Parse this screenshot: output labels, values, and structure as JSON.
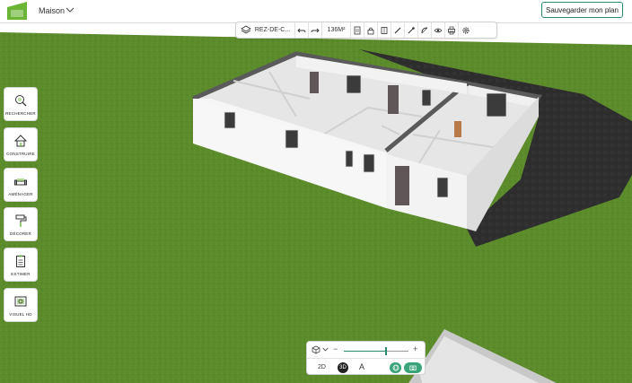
{
  "header": {
    "project_name": "Maison",
    "save_label": "Sauvegarder mon plan"
  },
  "toolbar": {
    "level_label": "REZ-DE-C...",
    "area_label": "136M²",
    "tools": [
      "undo-icon",
      "redo-icon",
      "document-icon",
      "lock-icon",
      "openings-icon",
      "pencil-icon",
      "dropper-icon",
      "measure-icon",
      "eye-icon",
      "print-icon",
      "settings-icon"
    ]
  },
  "sidebar": {
    "items": [
      {
        "label": "RECHERCHER",
        "icon": "search-icon"
      },
      {
        "label": "CONSTRUIRE",
        "icon": "house-icon"
      },
      {
        "label": "AMÉNAGER",
        "icon": "sofa-icon"
      },
      {
        "label": "DÉCORER",
        "icon": "paint-roller-icon"
      },
      {
        "label": "ESTIMER",
        "icon": "clipboard-icon"
      },
      {
        "label": "VISUEL HD",
        "icon": "photo-icon"
      }
    ]
  },
  "view_controls": {
    "mode_2d": "2D",
    "mode_3d": "3D",
    "mode_3d_selected": true,
    "text_mode": "A",
    "zoom_minus": "−",
    "zoom_plus": "+",
    "zoom_level": 0.65
  },
  "colors": {
    "accent": "#2a8a6a",
    "grass": "#5a8a2a",
    "pavement": "#2b2b2b",
    "wall": "#f4f4f4",
    "floor": "#e8e8e8"
  }
}
